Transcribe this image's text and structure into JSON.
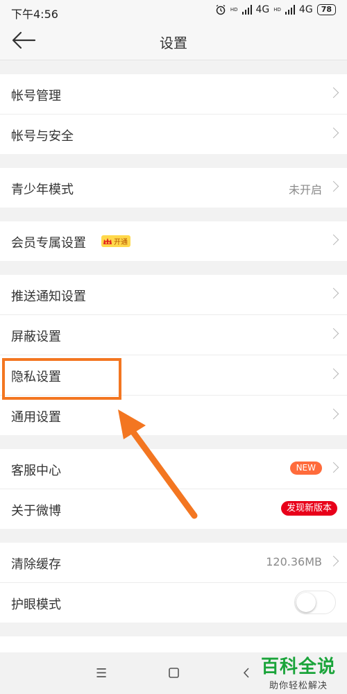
{
  "status": {
    "time": "下午4:56",
    "net1": "4G",
    "net2": "4G",
    "battery": "78",
    "hd": "HD"
  },
  "header": {
    "title": "设置"
  },
  "groups": [
    [
      {
        "label": "帐号管理"
      },
      {
        "label": "帐号与安全"
      }
    ],
    [
      {
        "label": "青少年模式",
        "value": "未开启"
      }
    ],
    [
      {
        "label": "会员专属设置",
        "badge": "开通"
      }
    ],
    [
      {
        "label": "推送通知设置"
      },
      {
        "label": "屏蔽设置"
      },
      {
        "label": "隐私设置"
      },
      {
        "label": "通用设置"
      }
    ],
    [
      {
        "label": "客服中心",
        "badge": "NEW"
      },
      {
        "label": "关于微博",
        "badge": "发现新版本"
      }
    ],
    [
      {
        "label": "清除缓存",
        "value": "120.36MB"
      },
      {
        "label": "护眼模式",
        "toggle": false
      }
    ]
  ],
  "watermark": {
    "title": "百科全说",
    "subtitle": "助你轻松解决"
  },
  "colors": {
    "highlight": "#f37621",
    "new_badge": "#ff6b3b",
    "update_badge": "#e8001a",
    "watermark": "#1aa43a"
  },
  "icons": {
    "back": "arrow-left-icon",
    "nav_menu": "menu-icon",
    "nav_home": "square-icon",
    "nav_back": "chevron-left-icon"
  }
}
